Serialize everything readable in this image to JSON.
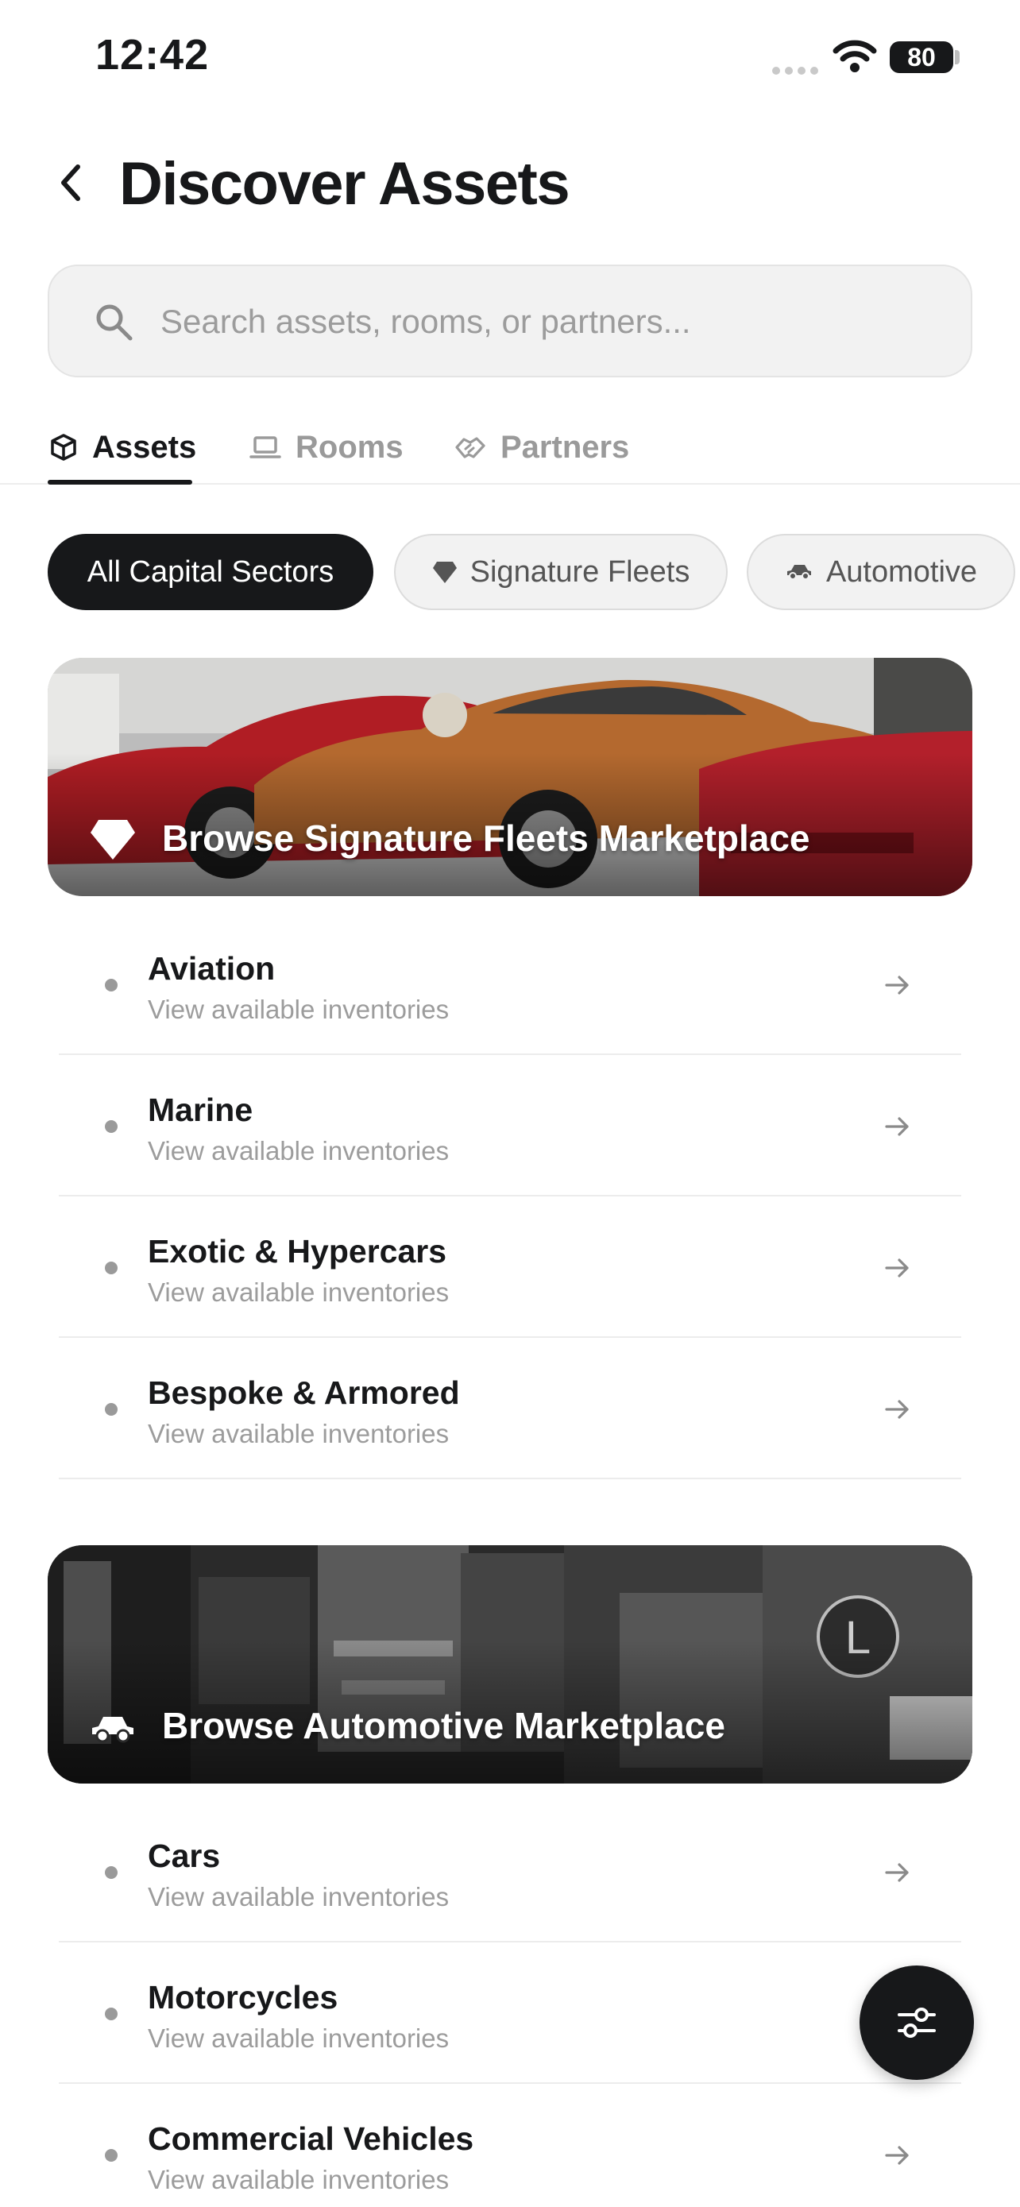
{
  "status_bar": {
    "time": "12:42",
    "battery": "80"
  },
  "header": {
    "title": "Discover Assets"
  },
  "search": {
    "placeholder": "Search assets, rooms, or partners..."
  },
  "tabs": [
    {
      "label": "Assets",
      "icon": "cube-icon",
      "active": true
    },
    {
      "label": "Rooms",
      "icon": "laptop-icon",
      "active": false
    },
    {
      "label": "Partners",
      "icon": "handshake-icon",
      "active": false
    }
  ],
  "chips": [
    {
      "label": "All Capital Sectors",
      "active": true
    },
    {
      "label": "Signature Fleets",
      "icon": "diamond-icon",
      "active": false
    },
    {
      "label": "Automotive",
      "icon": "car-icon",
      "active": false
    }
  ],
  "sections": [
    {
      "banner": "Browse Signature Fleets Marketplace",
      "icon": "diamond-icon",
      "items": [
        {
          "name": "Aviation",
          "sub": "View available inventories"
        },
        {
          "name": "Marine",
          "sub": "View available inventories"
        },
        {
          "name": "Exotic & Hypercars",
          "sub": "View available inventories"
        },
        {
          "name": "Bespoke & Armored",
          "sub": "View available inventories"
        }
      ]
    },
    {
      "banner": "Browse Automotive Marketplace",
      "icon": "car-icon",
      "items": [
        {
          "name": "Cars",
          "sub": "View available inventories"
        },
        {
          "name": "Motorcycles",
          "sub": "View available inventories"
        },
        {
          "name": "Commercial Vehicles",
          "sub": "View available inventories"
        }
      ]
    }
  ],
  "colors": {
    "text": "#17181a",
    "muted": "#9c9c9c",
    "surface": "#f2f2f2",
    "accent_dark": "#17181a"
  }
}
